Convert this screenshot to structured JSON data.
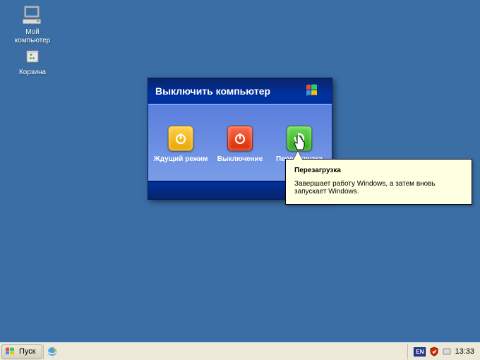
{
  "desktop": {
    "icons": [
      {
        "label": "Мой\nкомпьютер",
        "name": "my-computer-icon"
      },
      {
        "label": "Корзина",
        "name": "recycle-bin-icon"
      }
    ]
  },
  "shutdown_dialog": {
    "title": "Выключить компьютер",
    "options": {
      "standby": "Ждущий режим",
      "turnoff": "Выключение",
      "restart": "Перезагрузка"
    }
  },
  "tooltip": {
    "title": "Перезагрузка",
    "body": "Завершает работу Windows, а затем вновь запускает Windows."
  },
  "taskbar": {
    "start_label": "Пуск",
    "tray": {
      "lang_badge": "EN",
      "clock": "13:33"
    }
  }
}
